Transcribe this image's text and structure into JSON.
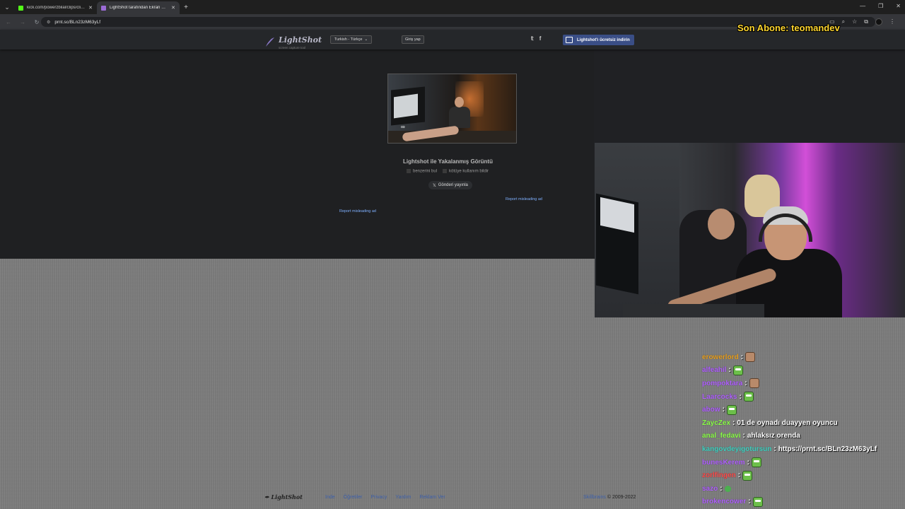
{
  "browser": {
    "tabs": [
      {
        "title": "kick.com/powerzbilal/clips/clip_",
        "favicon_color": "#53fc18"
      },
      {
        "title": "LightShot tarafından Ekran Görün",
        "favicon_color": "#9b6bd6"
      }
    ],
    "url": "prnt.sc/BLn23zM63yLf"
  },
  "lightshot": {
    "logo_name": "LightShot",
    "logo_tagline": "screen capture tool",
    "language": "Turkish - Türkçe",
    "login_label": "Giriş yap",
    "download_label": "Lightshot'ı ücretsiz indirin",
    "caption_title": "Lightshot ile Yakalanmış Görüntü",
    "find_similar": "benzerini bul",
    "report_abuse": "kötüye kullanım bildir",
    "post_label": "Gönderi yayınla",
    "report_ad_1": "Report misleading ad",
    "report_ad_2": "Report misleading ad"
  },
  "footer": {
    "logo": "LightShot",
    "links": [
      "Inde",
      "Öğretiler",
      "Privacy",
      "Yardım",
      "Reklam Ver"
    ],
    "brand": "Skillbrains",
    "copyright": "© 2009-2022"
  },
  "overlay": {
    "sub_banner": "Son Abone: teomandev"
  },
  "chat": [
    {
      "user": "erowerlord",
      "color": "#e8a020",
      "emote": "face",
      "text": ""
    },
    {
      "user": "alfeahil",
      "color": "#b060ff",
      "emote": "pepe",
      "text": ""
    },
    {
      "user": "pompoktara",
      "color": "#b060ff",
      "emote": "face",
      "text": ""
    },
    {
      "user": "Laarcocks",
      "color": "#b060ff",
      "emote": "pepe",
      "text": ""
    },
    {
      "user": "abow",
      "color": "#b060ff",
      "emote": "pepe",
      "text": ""
    },
    {
      "user": "ZaycZex",
      "color": "#8cff4a",
      "emote": "",
      "text": "01 de oynadı duayyen oyuncu"
    },
    {
      "user": "anal_fedavi",
      "color": "#8cff4a",
      "emote": "",
      "text": "ahlaksız orenda"
    },
    {
      "user": "kangovdeyigotursun",
      "color": "#40d0c0",
      "emote": "",
      "text": "https://prnt.sc/BLn23zM63yLf"
    },
    {
      "user": "bunesKerem",
      "color": "#b060ff",
      "emote": "pepe",
      "text": ""
    },
    {
      "user": "zorlfingen",
      "color": "#ff4a4a",
      "emote": "pepe",
      "text": ""
    },
    {
      "user": "sazo",
      "color": "#b060ff",
      "emote": "small-pepe",
      "text": ""
    },
    {
      "user": "brokencower",
      "color": "#b060ff",
      "emote": "pepe",
      "text": ""
    }
  ]
}
